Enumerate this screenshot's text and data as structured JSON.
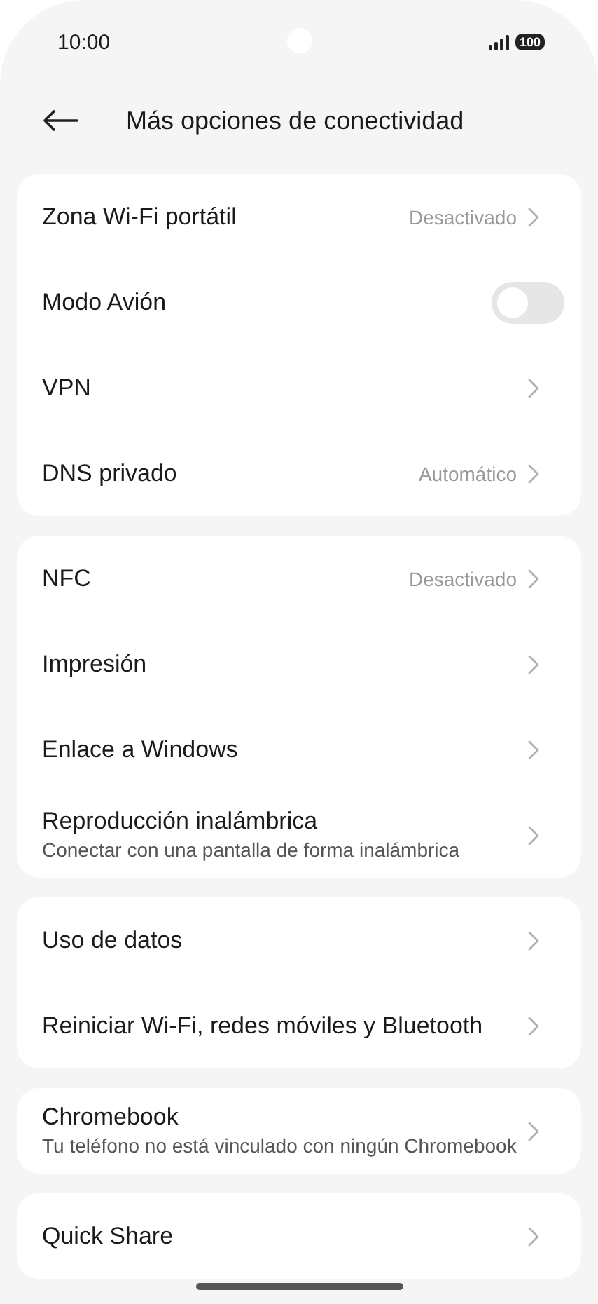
{
  "status_bar": {
    "time": "10:00",
    "battery": "100"
  },
  "header": {
    "title": "Más opciones de conectividad"
  },
  "sections": [
    {
      "items": [
        {
          "kind": "link",
          "label": "Zona Wi-Fi portátil",
          "value": "Desactivado"
        },
        {
          "kind": "toggle",
          "label": "Modo Avión",
          "on": false
        },
        {
          "kind": "link",
          "label": "VPN"
        },
        {
          "kind": "link",
          "label": "DNS privado",
          "value": "Automático"
        }
      ]
    },
    {
      "items": [
        {
          "kind": "link",
          "label": "NFC",
          "value": "Desactivado"
        },
        {
          "kind": "link",
          "label": "Impresión"
        },
        {
          "kind": "link",
          "label": "Enlace a Windows"
        },
        {
          "kind": "link",
          "label": "Reproducción inalámbrica",
          "subtitle": "Conectar con una pantalla de forma inalámbrica"
        }
      ]
    },
    {
      "items": [
        {
          "kind": "link",
          "label": "Uso de datos"
        },
        {
          "kind": "link",
          "label": "Reiniciar Wi-Fi, redes móviles y Bluetooth"
        }
      ]
    },
    {
      "items": [
        {
          "kind": "link",
          "label": "Chromebook",
          "subtitle": "Tu teléfono no está vinculado con ningún Chromebook"
        }
      ]
    },
    {
      "items": [
        {
          "kind": "link",
          "label": "Quick Share"
        }
      ]
    }
  ]
}
